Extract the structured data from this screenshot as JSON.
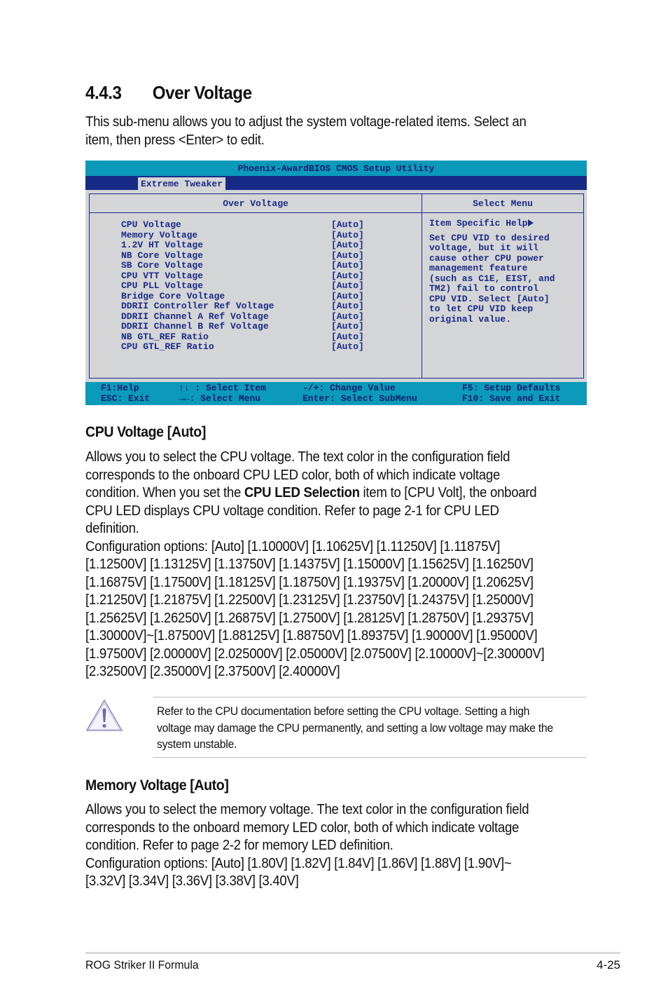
{
  "section": {
    "number": "4.4.3",
    "title": "Over Voltage",
    "intro": "This sub-menu allows you to adjust the system voltage-related items. Select an item, then press <Enter> to edit."
  },
  "bios": {
    "title": "Phoenix-AwardBIOS CMOS Setup Utility",
    "active_tab": "Extreme Tweaker",
    "left_panel_title": "Over Voltage",
    "right_panel_title": "Select Menu",
    "items": [
      {
        "label": "CPU Voltage",
        "value": "[Auto]"
      },
      {
        "label": "Memory Voltage",
        "value": "[Auto]"
      },
      {
        "label": "1.2V HT Voltage",
        "value": "[Auto]"
      },
      {
        "label": "NB Core Voltage",
        "value": "[Auto]"
      },
      {
        "label": "SB Core Voltage",
        "value": "[Auto]"
      },
      {
        "label": "CPU VTT Voltage",
        "value": "[Auto]"
      },
      {
        "label": "CPU PLL Voltage",
        "value": "[Auto]"
      },
      {
        "label": "Bridge Core Voltage",
        "value": "[Auto]"
      },
      {
        "label": "DDRII Controller Ref Voltage",
        "value": "[Auto]"
      },
      {
        "label": "DDRII Channel A Ref Voltage",
        "value": "[Auto]"
      },
      {
        "label": "DDRII Channel B Ref Voltage",
        "value": "[Auto]"
      },
      {
        "label": "NB GTL_REF Ratio",
        "value": "[Auto]"
      },
      {
        "label": "CPU GTL_REF Ratio",
        "value": "[Auto]"
      }
    ],
    "help_title": "Item Specific Help",
    "help_arrow_icon": "right-triangle",
    "help_body": "Set CPU VID to desired\nvoltage, but it will\ncause other CPU power\nmanagement feature\n(such as C1E, EIST, and\nTM2) fail to control\nCPU VID. Select [Auto]\nto let CPU VID keep\noriginal value.",
    "footer": {
      "col1": "F1:Help\nESC: Exit",
      "col2": "↑↓ : Select Item\n→←: Select Menu",
      "col3": "-/+: Change Value\nEnter: Select SubMenu",
      "col4": "F5: Setup Defaults\nF10: Save and Exit"
    },
    "colors": {
      "title_bar": "#0b9ab9",
      "menu_bar": "#162a85",
      "panel_bg": "#d4d5d7",
      "text": "#1a2a86"
    }
  },
  "cpu_voltage": {
    "heading": "CPU Voltage [Auto]",
    "desc_part1": "Allows you to select the CPU voltage. The text color in the configuration field corresponds to the onboard CPU LED color, both of which indicate voltage condition. When you set the ",
    "desc_bold": "CPU LED Selection",
    "desc_part2": " item to [CPU Volt], the onboard CPU LED displays CPU voltage condition. Refer to page 2-1 for CPU LED definition.",
    "options": "Configuration options: [Auto] [1.10000V] [1.10625V] [1.11250V] [1.11875V] [1.12500V] [1.13125V] [1.13750V] [1.14375V] [1.15000V] [1.15625V] [1.16250V] [1.16875V] [1.17500V] [1.18125V] [1.18750V] [1.19375V] [1.20000V] [1.20625V] [1.21250V] [1.21875V] [1.22500V] [1.23125V] [1.23750V] [1.24375V] [1.25000V] [1.25625V] [1.26250V] [1.26875V] [1.27500V] [1.28125V] [1.28750V] [1.29375V] [1.30000V]~[1.87500V] [1.88125V] [1.88750V] [1.89375V] [1.90000V] [1.95000V] [1.97500V] [2.00000V] [2.025000V] [2.05000V] [2.07500V] [2.10000V]~[2.30000V] [2.32500V] [2.35000V] [2.37500V] [2.40000V]"
  },
  "note": {
    "icon": "warning-icon",
    "text": "Refer to the CPU documentation before setting the CPU voltage. Setting a high voltage may damage the CPU permanently, and setting a low voltage may make the system unstable."
  },
  "memory_voltage": {
    "heading": "Memory Voltage [Auto]",
    "desc": "Allows you to select the memory voltage. The text color in the configuration field corresponds to the onboard memory LED color, both of which indicate voltage condition. Refer to page 2-2 for memory LED definition.",
    "options": "Configuration options: [Auto] [1.80V] [1.82V] [1.84V] [1.86V] [1.88V] [1.90V]~ [3.32V] [3.34V] [3.36V] [3.38V] [3.40V]"
  },
  "page_footer": {
    "product": "ROG Striker II Formula",
    "page": "4-25"
  }
}
